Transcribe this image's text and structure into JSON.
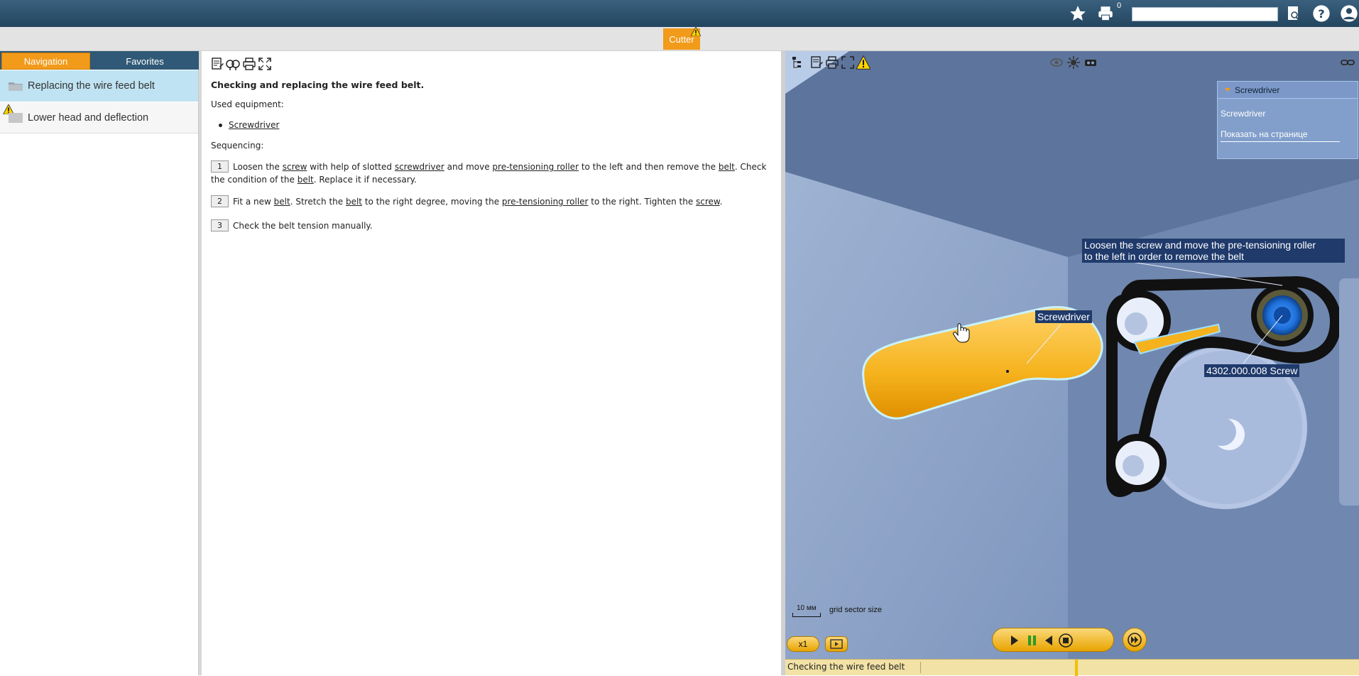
{
  "header": {
    "print_badge": "0",
    "search": {
      "value": "",
      "placeholder": ""
    },
    "icons": [
      "favorites-star-icon",
      "print-icon",
      "search-doc-icon",
      "help-icon",
      "user-icon"
    ]
  },
  "tabs": {
    "active": "Cutter"
  },
  "navigation": {
    "tabs": [
      "Navigation",
      "Favorites"
    ],
    "items": [
      {
        "label": "Replacing the wire feed belt",
        "warning": false
      },
      {
        "label": "Lower head and deflection",
        "warning": true
      }
    ]
  },
  "document": {
    "title": "Checking and replacing the wire feed belt.",
    "used_equipment_label": "Used equipment:",
    "equipment": [
      "Screwdriver"
    ],
    "sequencing_label": "Sequencing:",
    "steps": [
      {
        "num": "1"
      },
      {
        "num": "2"
      },
      {
        "num": "3",
        "text": "Check the belt tension manually."
      }
    ],
    "step1": {
      "t1": "Loosen the ",
      "l1": "screw",
      "t2": " with help of slotted ",
      "l2": "screwdriver",
      "t3": " and move ",
      "l3": "pre-tensioning roller",
      "t4": " to the left and then remove the ",
      "l4": "belt",
      "t5": ". Check the condition of the ",
      "l5": "belt",
      "t6": ". Replace it if necessary."
    },
    "step2": {
      "t1": "Fit a new ",
      "l1": "belt",
      "t2": ". Stretch the ",
      "l2": "belt",
      "t3": " to the right degree, moving the ",
      "l3": "pre-tensioning roller",
      "t4": " to the right.  Tighten the ",
      "l4": "screw",
      "t5": "."
    }
  },
  "viewer": {
    "popup": {
      "title": "Screwdriver",
      "name": "Screwdriver",
      "show_on_page": "Показать на странице"
    },
    "callouts": {
      "main_line1": "Loosen the screw and move the pre-tensioning roller",
      "main_line2": "to the left in order to remove the belt",
      "screwdriver": "Screwdriver",
      "screw": "4302.000.008 Screw"
    },
    "scale": {
      "value": "10 мм",
      "label": "grid sector size"
    },
    "speed": "x1",
    "status": "Checking the wire feed belt",
    "colors": {
      "handle": "#f5b21c",
      "roller": "#1e6fd8",
      "belt": "#111111",
      "accent": "#f29a1a"
    }
  }
}
